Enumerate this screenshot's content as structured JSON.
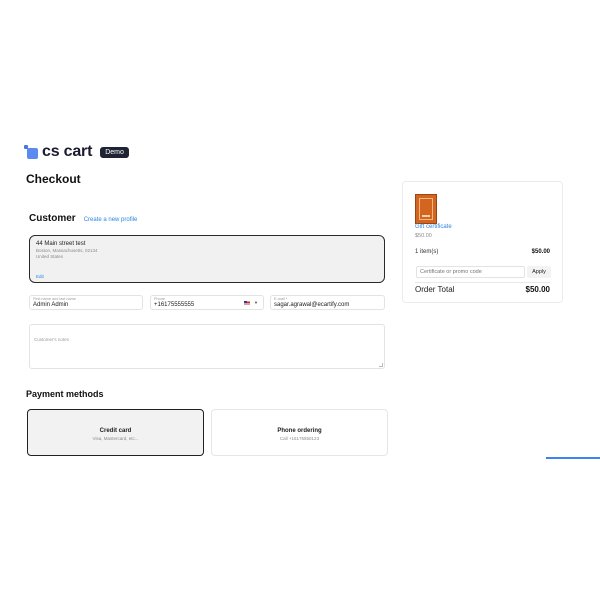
{
  "brand": {
    "logo_text": "cs cart",
    "badge": "Demo"
  },
  "page_title": "Checkout",
  "customer": {
    "title": "Customer",
    "create_profile_link": "Create a new profile",
    "address": {
      "line1": "44 Main street test",
      "line2": "Boston, Massachusetts, 02134",
      "line3": "United States",
      "edit_label": "Edit"
    },
    "fields": {
      "name": {
        "label": "First name and last name",
        "value": "Admin Admin"
      },
      "phone": {
        "label": "Phone",
        "value": "+16175555555"
      },
      "email": {
        "label": "E-mail *",
        "value": "sagar.agrawal@ecartify.com"
      }
    },
    "notes_placeholder": "Customer's notes"
  },
  "payment": {
    "title": "Payment methods",
    "methods": [
      {
        "name": "Credit card",
        "description": "Visa, Mastercard, etc...",
        "selected": true
      },
      {
        "name": "Phone ordering",
        "description": "Call +16175550123",
        "selected": false
      }
    ]
  },
  "summary": {
    "product_name": "Gift certificate",
    "product_price": "$50.00",
    "items_label": "1 item(s)",
    "items_amount": "$50.00",
    "promo_placeholder": "Certificate or promo code",
    "apply_label": "Apply",
    "total_label": "Order Total",
    "total_amount": "$50.00"
  },
  "colors": {
    "accent": "#2e86de",
    "badge_bg": "#1e2434",
    "logo_blue": "#5b8bf0",
    "gift_orange": "#d4651e"
  }
}
